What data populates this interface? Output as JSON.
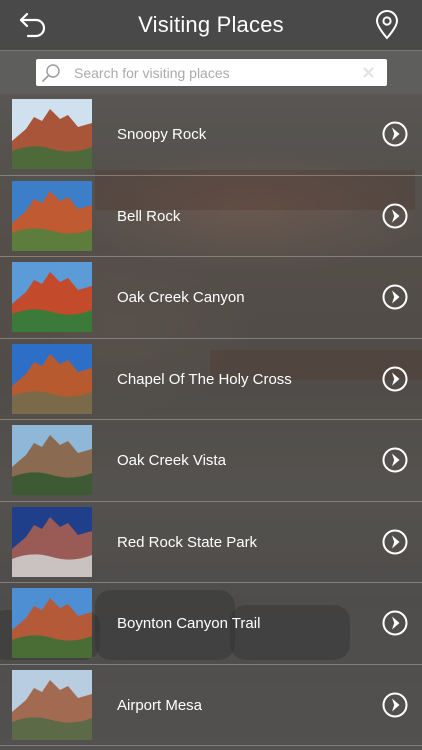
{
  "header": {
    "title": "Visiting Places",
    "back_icon": "back-arrow-icon",
    "map_icon": "map-pin-icon"
  },
  "search": {
    "placeholder": "Search for visiting places",
    "value": ""
  },
  "places": [
    {
      "name": "Snoopy Rock",
      "thumb": {
        "sky": "#cfe1ee",
        "rock": "#a8553a",
        "ground": "#4f6a3a"
      }
    },
    {
      "name": "Bell Rock",
      "thumb": {
        "sky": "#3c7fc8",
        "rock": "#c05a33",
        "ground": "#5c7d3c"
      }
    },
    {
      "name": "Oak Creek Canyon",
      "thumb": {
        "sky": "#5a9bd8",
        "rock": "#c34a2a",
        "ground": "#3c7a3a"
      }
    },
    {
      "name": "Chapel Of The Holy Cross",
      "thumb": {
        "sky": "#2d6fc6",
        "rock": "#b85a30",
        "ground": "#7a6a4a"
      }
    },
    {
      "name": "Oak Creek Vista",
      "thumb": {
        "sky": "#8fb7d8",
        "rock": "#8a6a50",
        "ground": "#3d5a34"
      }
    },
    {
      "name": "Red Rock State Park",
      "thumb": {
        "sky": "#1f3f8a",
        "rock": "#9a5a55",
        "ground": "#c9c2c0"
      }
    },
    {
      "name": "Boynton Canyon Trail",
      "thumb": {
        "sky": "#4d8fd2",
        "rock": "#b55a38",
        "ground": "#4a6d36"
      }
    },
    {
      "name": "Airport Mesa",
      "thumb": {
        "sky": "#b9cde0",
        "rock": "#a36a52",
        "ground": "#5d6a48"
      }
    }
  ],
  "row_icon": "chevron-right-circle-icon"
}
